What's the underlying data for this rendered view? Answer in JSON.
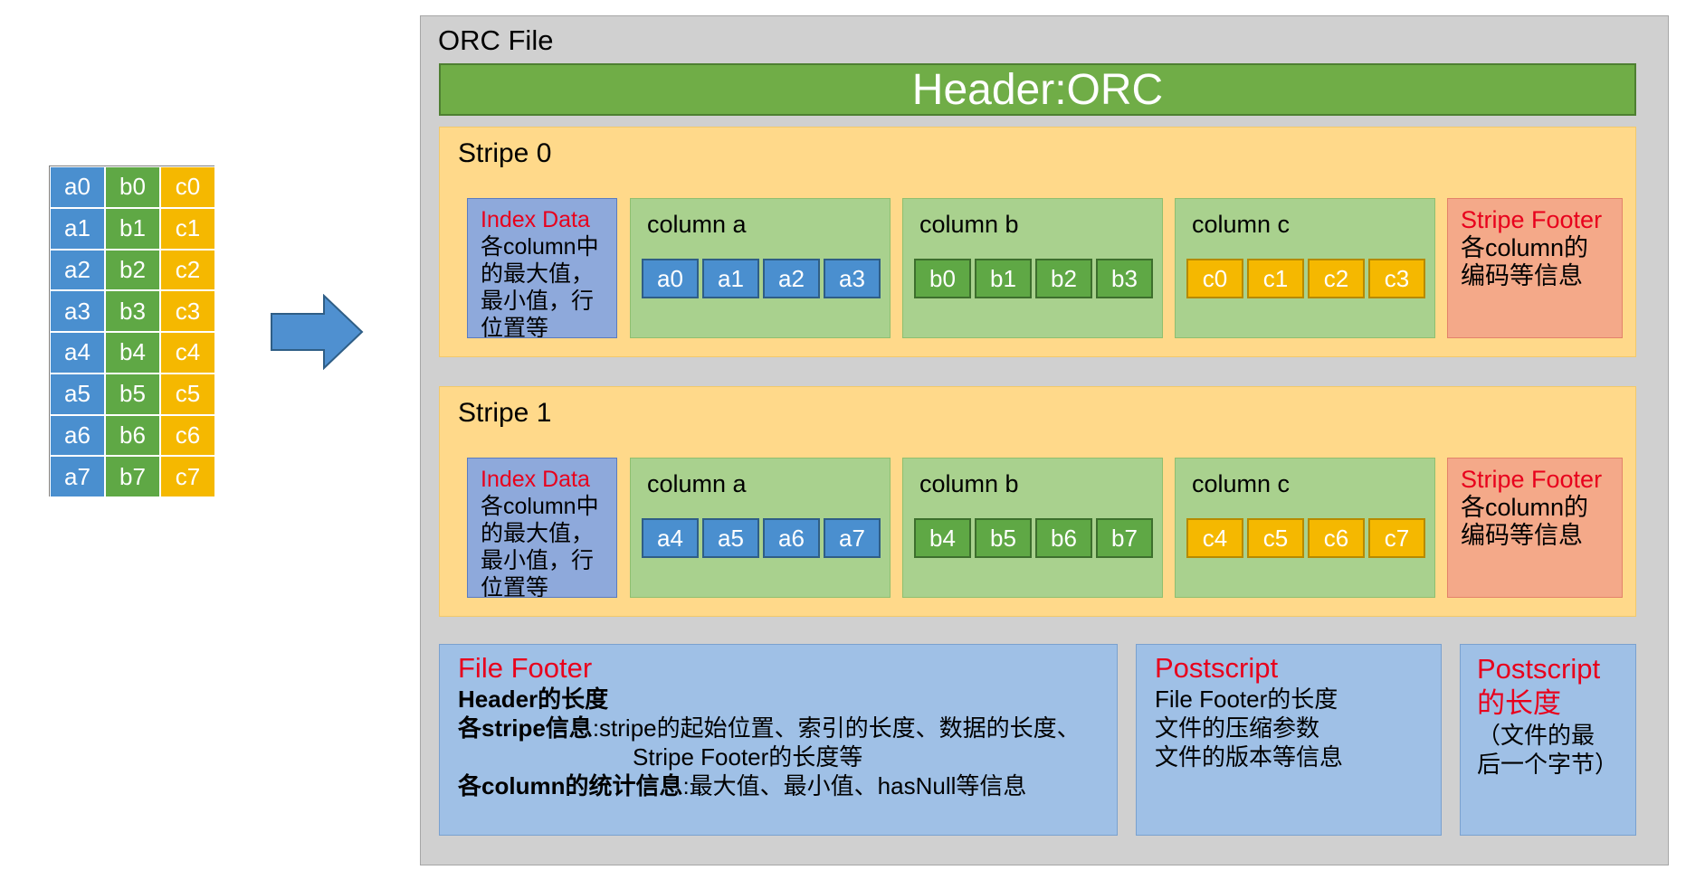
{
  "table": {
    "rows": [
      [
        "a0",
        "b0",
        "c0"
      ],
      [
        "a1",
        "b1",
        "c1"
      ],
      [
        "a2",
        "b2",
        "c2"
      ],
      [
        "a3",
        "b3",
        "c3"
      ],
      [
        "a4",
        "b4",
        "c4"
      ],
      [
        "a5",
        "b5",
        "c5"
      ],
      [
        "a6",
        "b6",
        "c6"
      ],
      [
        "a7",
        "b7",
        "c7"
      ]
    ]
  },
  "orc": {
    "title": "ORC File",
    "header": "Header:ORC",
    "stripes": [
      {
        "title": "Stripe 0",
        "index_title": "Index Data",
        "index_lines": [
          "各column中",
          "的最大值，",
          "最小值，行",
          "位置等"
        ],
        "columns": [
          {
            "title": "column a",
            "values": [
              "a0",
              "a1",
              "a2",
              "a3"
            ]
          },
          {
            "title": "column b",
            "values": [
              "b0",
              "b1",
              "b2",
              "b3"
            ]
          },
          {
            "title": "column c",
            "values": [
              "c0",
              "c1",
              "c2",
              "c3"
            ]
          }
        ],
        "footer_title": "Stripe Footer",
        "footer_lines": [
          "各column的",
          "编码等信息"
        ]
      },
      {
        "title": "Stripe 1",
        "index_title": "Index Data",
        "index_lines": [
          "各column中",
          "的最大值，",
          "最小值，行",
          "位置等"
        ],
        "columns": [
          {
            "title": "column a",
            "values": [
              "a4",
              "a5",
              "a6",
              "a7"
            ]
          },
          {
            "title": "column b",
            "values": [
              "b4",
              "b5",
              "b6",
              "b7"
            ]
          },
          {
            "title": "column c",
            "values": [
              "c4",
              "c5",
              "c6",
              "c7"
            ]
          }
        ],
        "footer_title": "Stripe Footer",
        "footer_lines": [
          "各column的",
          "编码等信息"
        ]
      }
    ],
    "file_footer": {
      "title": "File Footer",
      "line1_bold": "Header的长度",
      "line2_bold": "各stripe信息",
      "line2_text": ":stripe的起始位置、索引的长度、数据的长度、",
      "line3_text": "Stripe Footer的长度等",
      "line4_bold": "各column的统计信息",
      "line4_text": ":最大值、最小值、hasNull等信息"
    },
    "postscript": {
      "title": "Postscript",
      "lines": [
        "File Footer的长度",
        "文件的压缩参数",
        "文件的版本等信息"
      ]
    },
    "postscript_len": {
      "title_lines": [
        "Postscript",
        "的长度"
      ],
      "lines": [
        "（文件的最",
        "后一个字节）"
      ]
    }
  }
}
